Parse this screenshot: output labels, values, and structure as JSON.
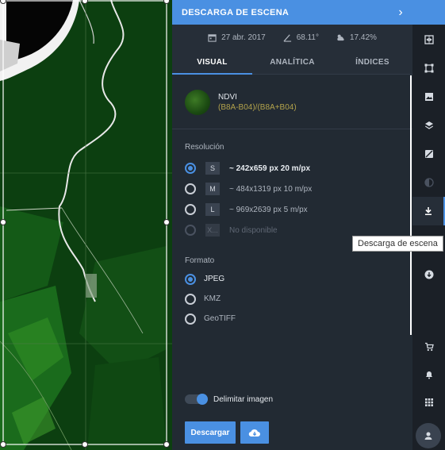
{
  "panel": {
    "title": "DESCARGA DE ESCENA",
    "meta": {
      "date": "27 abr. 2017",
      "angle": "68.11°",
      "cloud": "17.42%"
    },
    "tabs": [
      "VISUAL",
      "ANALÍTICA",
      "ÍNDICES"
    ],
    "active_tab": "VISUAL",
    "layer": {
      "name": "NDVI",
      "formula": "(B8A-B04)/(B8A+B04)"
    }
  },
  "resolution": {
    "label": "Resolución",
    "options": [
      {
        "size": "S",
        "text": "~ 242x659 px 20 m/px",
        "selected": true,
        "disabled": false
      },
      {
        "size": "M",
        "text": "~ 484x1319 px 10 m/px",
        "selected": false,
        "disabled": false
      },
      {
        "size": "L",
        "text": "~ 969x2639 px 5 m/px",
        "selected": false,
        "disabled": false
      },
      {
        "size": "X...",
        "text": "No disponible",
        "selected": false,
        "disabled": true
      }
    ]
  },
  "format": {
    "label": "Formato",
    "options": [
      {
        "text": "JPEG",
        "selected": true
      },
      {
        "text": "KMZ",
        "selected": false
      },
      {
        "text": "GeoTIFF",
        "selected": false
      }
    ]
  },
  "clip": {
    "label": "Delimitar imagen",
    "enabled": true
  },
  "actions": {
    "download": "Descargar"
  },
  "rail": {
    "items": [
      "compare-icon",
      "crop-icon",
      "image-icon",
      "layers-icon",
      "pin-off-icon",
      "contrast-icon",
      "download-icon",
      "arrow-down-circle-icon"
    ],
    "bottom": [
      "cart-icon",
      "bell-icon",
      "grid-icon",
      "user-icon"
    ],
    "active": "download-icon"
  },
  "tooltip": "Descarga de escena",
  "colors": {
    "accent": "#4a90e2",
    "panel": "#222a33",
    "rail": "#1b2027",
    "formula": "#b2a24b"
  }
}
